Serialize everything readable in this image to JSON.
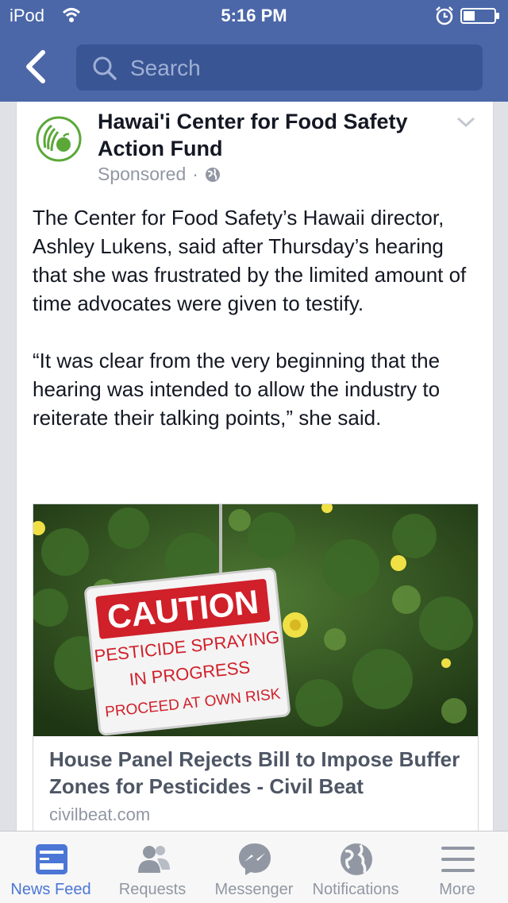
{
  "status_bar": {
    "carrier": "iPod",
    "time": "5:16 PM"
  },
  "nav": {
    "search_placeholder": "Search"
  },
  "post": {
    "page_name": "Hawai'i Center for Food Safety Action Fund",
    "sponsored": "Sponsored",
    "separator": "·",
    "paragraphs": [
      "The Center for Food Safety’s Hawaii director, Ashley Lukens, said after Thursday’s hearing that she was frustrated by the limited amount of time advocates were given to testify.",
      "“It was clear from the very beginning that the hearing was intended to allow the industry to reiterate their talking points,” she said."
    ],
    "link": {
      "sign_line1": "CAUTION",
      "sign_line2": "PESTICIDE SPRAYING",
      "sign_line3": "IN PROGRESS",
      "sign_line4": "PROCEED AT OWN RISK",
      "title": "House Panel Rejects Bill to Impose Buffer Zones for Pesticides - Civil Beat",
      "domain": "civilbeat.com"
    }
  },
  "tabs": [
    {
      "label": "News Feed",
      "icon": "news-feed-icon",
      "active": true
    },
    {
      "label": "Requests",
      "icon": "friend-requests-icon",
      "active": false
    },
    {
      "label": "Messenger",
      "icon": "messenger-icon",
      "active": false
    },
    {
      "label": "Notifications",
      "icon": "globe-icon",
      "active": false
    },
    {
      "label": "More",
      "icon": "menu-icon",
      "active": false
    }
  ],
  "colors": {
    "brand_blue": "#4b67a8",
    "active_tab": "#4b76d6",
    "logo_green": "#5ba839",
    "sign_red": "#d0202a"
  }
}
